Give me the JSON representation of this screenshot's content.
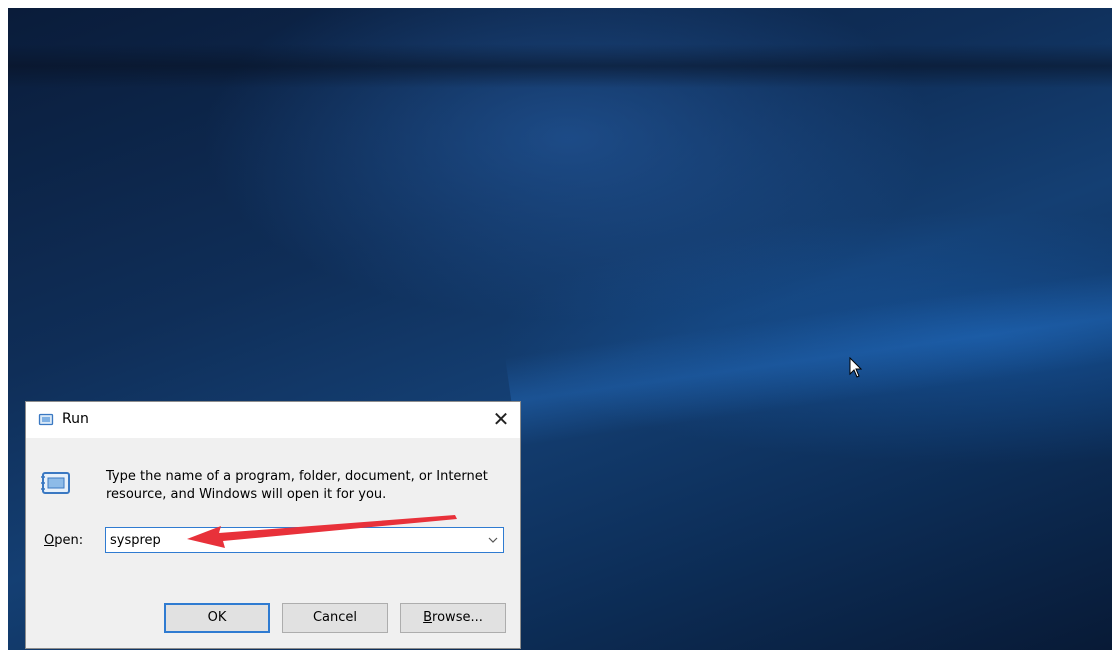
{
  "dialog": {
    "title": "Run",
    "description_line1": "Type the name of a program, folder, document, or Internet",
    "description_line2": "resource, and Windows will open it for you.",
    "open_label_prefix": "O",
    "open_label_rest": "pen:",
    "open_value": "sysprep",
    "close_glyph": "✕",
    "buttons": {
      "ok": "OK",
      "cancel": "Cancel",
      "browse_prefix": "B",
      "browse_rest": "rowse..."
    }
  },
  "icons": {
    "title_icon": "run-icon",
    "big_icon": "run-icon",
    "dropdown": "chevron-down-icon",
    "cursor": "mouse-pointer-icon"
  },
  "annotation": {
    "arrow_color": "#e8313a"
  },
  "colors": {
    "accent": "#2f7bd1",
    "dialog_bg": "#f0f0f0"
  }
}
